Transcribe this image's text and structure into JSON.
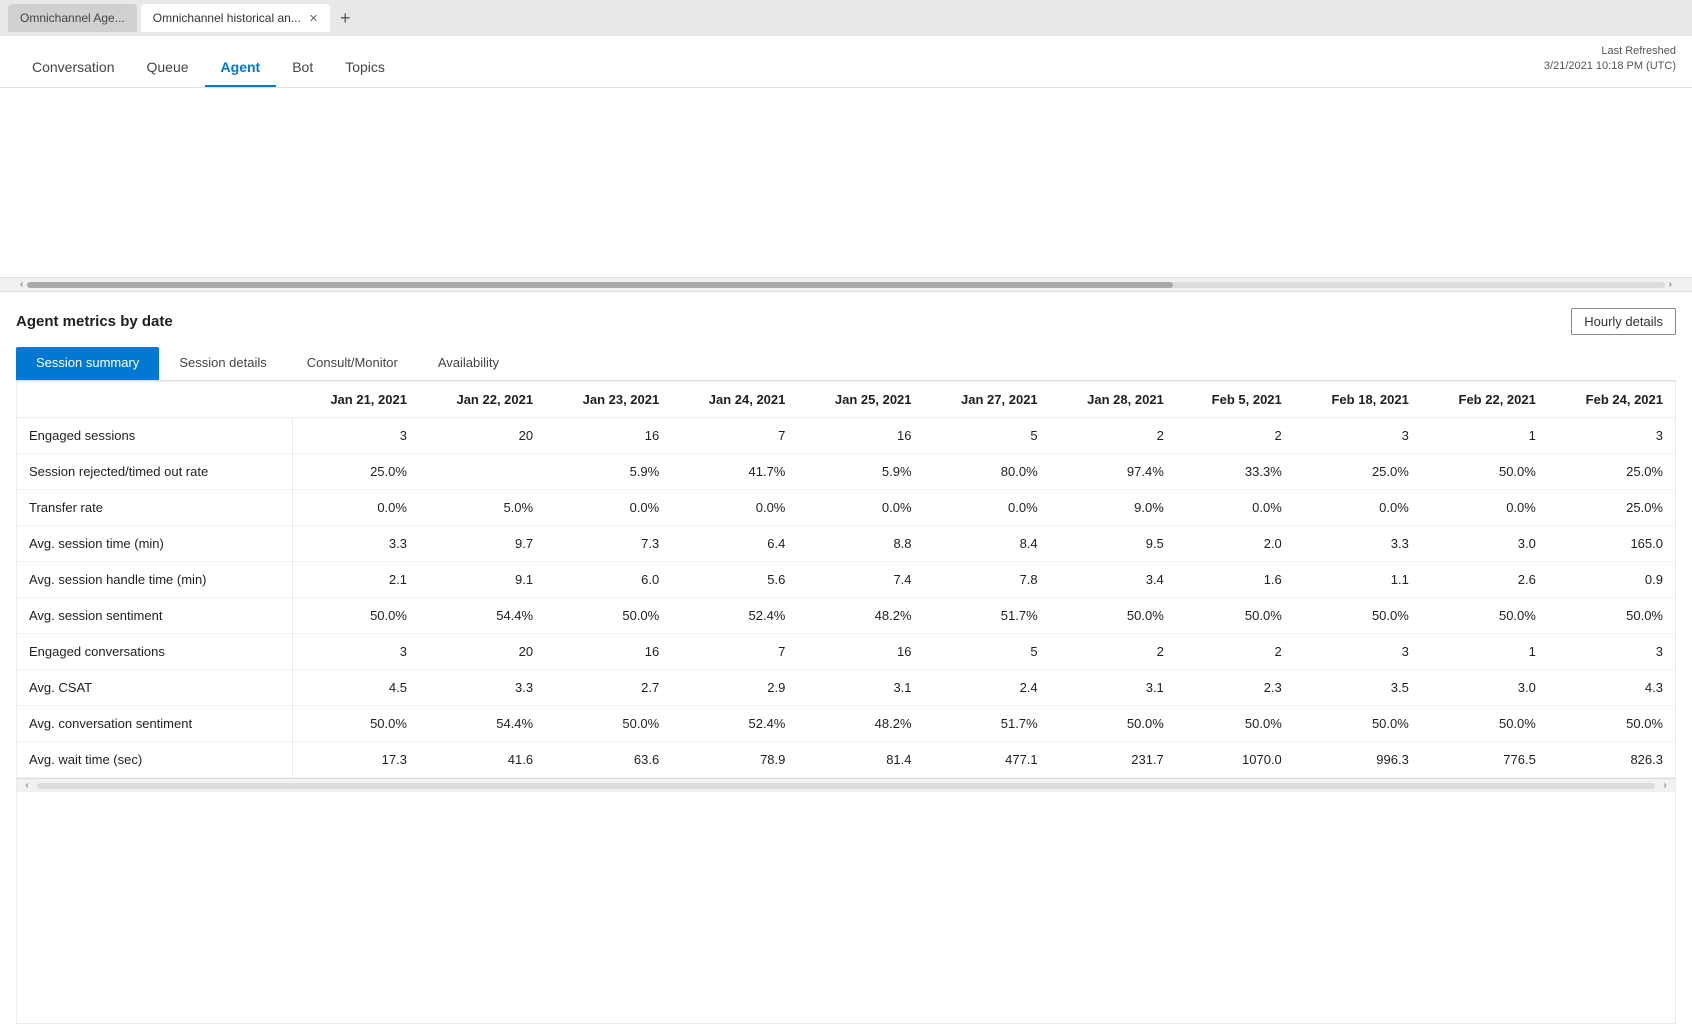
{
  "browser": {
    "tabs": [
      {
        "id": "tab1",
        "label": "Omnichannel Age...",
        "active": false
      },
      {
        "id": "tab2",
        "label": "Omnichannel historical an...",
        "active": true
      }
    ],
    "add_tab_icon": "+"
  },
  "nav": {
    "items": [
      {
        "id": "conversation",
        "label": "Conversation",
        "active": false
      },
      {
        "id": "queue",
        "label": "Queue",
        "active": false
      },
      {
        "id": "agent",
        "label": "Agent",
        "active": true
      },
      {
        "id": "bot",
        "label": "Bot",
        "active": false
      },
      {
        "id": "topics",
        "label": "Topics",
        "active": false
      }
    ],
    "last_refreshed_label": "Last Refreshed",
    "last_refreshed_value": "3/21/2021 10:18 PM (UTC)"
  },
  "metrics_section": {
    "title": "Agent metrics by date",
    "hourly_details_label": "Hourly details",
    "sub_tabs": [
      {
        "id": "session_summary",
        "label": "Session summary",
        "active": true
      },
      {
        "id": "session_details",
        "label": "Session details",
        "active": false
      },
      {
        "id": "consult_monitor",
        "label": "Consult/Monitor",
        "active": false
      },
      {
        "id": "availability",
        "label": "Availability",
        "active": false
      }
    ],
    "table": {
      "columns": [
        {
          "id": "metric",
          "label": ""
        },
        {
          "id": "jan21",
          "label": "Jan 21, 2021"
        },
        {
          "id": "jan22",
          "label": "Jan 22, 2021"
        },
        {
          "id": "jan23",
          "label": "Jan 23, 2021"
        },
        {
          "id": "jan24",
          "label": "Jan 24, 2021"
        },
        {
          "id": "jan25",
          "label": "Jan 25, 2021"
        },
        {
          "id": "jan27",
          "label": "Jan 27, 2021"
        },
        {
          "id": "jan28",
          "label": "Jan 28, 2021"
        },
        {
          "id": "feb5",
          "label": "Feb 5, 2021"
        },
        {
          "id": "feb18",
          "label": "Feb 18, 2021"
        },
        {
          "id": "feb22",
          "label": "Feb 22, 2021"
        },
        {
          "id": "feb24",
          "label": "Feb 24, 2021"
        }
      ],
      "rows": [
        {
          "metric": "Engaged sessions",
          "jan21": "3",
          "jan22": "20",
          "jan23": "16",
          "jan24": "7",
          "jan25": "16",
          "jan27": "5",
          "jan28": "2",
          "feb5": "2",
          "feb18": "3",
          "feb22": "1",
          "feb24": "3"
        },
        {
          "metric": "Session rejected/timed out rate",
          "jan21": "25.0%",
          "jan22": "",
          "jan23": "5.9%",
          "jan24": "41.7%",
          "jan25": "5.9%",
          "jan27": "80.0%",
          "jan28": "97.4%",
          "feb5": "33.3%",
          "feb18": "25.0%",
          "feb22": "50.0%",
          "feb24": "25.0%"
        },
        {
          "metric": "Transfer rate",
          "jan21": "0.0%",
          "jan22": "5.0%",
          "jan23": "0.0%",
          "jan24": "0.0%",
          "jan25": "0.0%",
          "jan27": "0.0%",
          "jan28": "9.0%",
          "feb5": "0.0%",
          "feb18": "0.0%",
          "feb22": "0.0%",
          "feb24": "25.0%"
        },
        {
          "metric": "Avg. session time (min)",
          "jan21": "3.3",
          "jan22": "9.7",
          "jan23": "7.3",
          "jan24": "6.4",
          "jan25": "8.8",
          "jan27": "8.4",
          "jan28": "9.5",
          "feb5": "2.0",
          "feb18": "3.3",
          "feb22": "3.0",
          "feb24": "165.0"
        },
        {
          "metric": "Avg. session handle time (min)",
          "jan21": "2.1",
          "jan22": "9.1",
          "jan23": "6.0",
          "jan24": "5.6",
          "jan25": "7.4",
          "jan27": "7.8",
          "jan28": "3.4",
          "feb5": "1.6",
          "feb18": "1.1",
          "feb22": "2.6",
          "feb24": "0.9"
        },
        {
          "metric": "Avg. session sentiment",
          "jan21": "50.0%",
          "jan22": "54.4%",
          "jan23": "50.0%",
          "jan24": "52.4%",
          "jan25": "48.2%",
          "jan27": "51.7%",
          "jan28": "50.0%",
          "feb5": "50.0%",
          "feb18": "50.0%",
          "feb22": "50.0%",
          "feb24": "50.0%"
        },
        {
          "metric": "Engaged conversations",
          "jan21": "3",
          "jan22": "20",
          "jan23": "16",
          "jan24": "7",
          "jan25": "16",
          "jan27": "5",
          "jan28": "2",
          "feb5": "2",
          "feb18": "3",
          "feb22": "1",
          "feb24": "3"
        },
        {
          "metric": "Avg. CSAT",
          "jan21": "4.5",
          "jan22": "3.3",
          "jan23": "2.7",
          "jan24": "2.9",
          "jan25": "3.1",
          "jan27": "2.4",
          "jan28": "3.1",
          "feb5": "2.3",
          "feb18": "3.5",
          "feb22": "3.0",
          "feb24": "4.3"
        },
        {
          "metric": "Avg. conversation sentiment",
          "jan21": "50.0%",
          "jan22": "54.4%",
          "jan23": "50.0%",
          "jan24": "52.4%",
          "jan25": "48.2%",
          "jan27": "51.7%",
          "jan28": "50.0%",
          "feb5": "50.0%",
          "feb18": "50.0%",
          "feb22": "50.0%",
          "feb24": "50.0%"
        },
        {
          "metric": "Avg. wait time (sec)",
          "jan21": "17.3",
          "jan22": "41.6",
          "jan23": "63.6",
          "jan24": "78.9",
          "jan25": "81.4",
          "jan27": "477.1",
          "jan28": "231.7",
          "feb5": "1070.0",
          "feb18": "996.3",
          "feb22": "776.5",
          "feb24": "826.3"
        }
      ]
    }
  }
}
